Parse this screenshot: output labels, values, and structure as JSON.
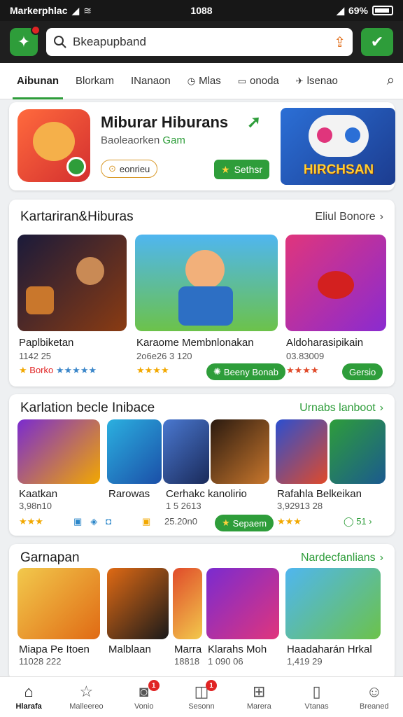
{
  "status_bar": {
    "carrier": "Markerphlac",
    "time": "1088",
    "battery": "69%"
  },
  "app_bar": {
    "search_value": "Bkeapupband"
  },
  "tabs": [
    {
      "label": "Aibunan",
      "icon": ""
    },
    {
      "label": "Blorkam",
      "icon": ""
    },
    {
      "label": "INanaon",
      "icon": ""
    },
    {
      "label": "Mlas",
      "icon": "clock-icon"
    },
    {
      "label": "onoda",
      "icon": "square-icon"
    },
    {
      "label": "lsenao",
      "icon": "plane-icon"
    }
  ],
  "featured": {
    "title": "Miburar Hiburans",
    "subtitle_prefix": "Baoleaorken ",
    "subtitle_accent": "Gam",
    "pill_label": "eonrieu",
    "button_label": "Sethsr",
    "banner_text": "HIRCHSAN",
    "colors": {
      "accent": "#2e9d3a"
    }
  },
  "section1": {
    "title": "Kartariran&Hiburas",
    "more_label": "Eliul Bonore",
    "items": [
      {
        "label": "Paplbiketan",
        "meta": "1142 25",
        "rating": "Borko",
        "stars_text": "★★★★★"
      },
      {
        "label": "Karaome Membnlonakan",
        "meta": "2o6e26 3 120",
        "stars_text": "★★★★",
        "button_label": "Beeny Bonab"
      },
      {
        "label": "Aldoharasipikain",
        "meta": "03.83009",
        "stars_text": "★★★★",
        "button_label": "Gersio"
      }
    ]
  },
  "section2": {
    "title": "Karlation becle Inibace",
    "more_label": "Urnabs lanboot",
    "items": [
      {
        "label": "Kaatkan",
        "meta": "3,98n10",
        "stars_text": "★★★"
      },
      {
        "label": "Rarowas",
        "meta": ""
      },
      {
        "label": "Cerhakc kanolirio",
        "meta": "1 5 2613",
        "extra": "25.20n0",
        "button_label": "Sepaem"
      },
      {
        "label": "Rafahla Belkeikan",
        "meta": "3,92913 28",
        "stars_text": "★★★",
        "extra": "51"
      }
    ]
  },
  "section3": {
    "title": "Garnapan",
    "more_label": "Nardecfanlians",
    "items": [
      {
        "label": "Miapa Pe Itoen",
        "meta": "11028 222"
      },
      {
        "label": "Malblaan",
        "meta": ""
      },
      {
        "label": "Marra",
        "meta": "18818"
      },
      {
        "label": "Klarahs Moh",
        "meta": "1 090 06"
      },
      {
        "label": "Haadaharán Hrkal",
        "meta": "1,419 29"
      }
    ]
  },
  "bottom_nav": [
    {
      "label": "Hlarafa",
      "icon": "home-icon",
      "badge": ""
    },
    {
      "label": "Malleereo",
      "icon": "star-icon",
      "badge": ""
    },
    {
      "label": "Vonio",
      "icon": "chat-icon",
      "badge": "1"
    },
    {
      "label": "Sesonn",
      "icon": "gamepad-icon",
      "badge": "1"
    },
    {
      "label": "Marera",
      "icon": "grid-icon",
      "badge": ""
    },
    {
      "label": "Vtanas",
      "icon": "book-icon",
      "badge": ""
    },
    {
      "label": "Breaned",
      "icon": "person-icon",
      "badge": ""
    }
  ]
}
